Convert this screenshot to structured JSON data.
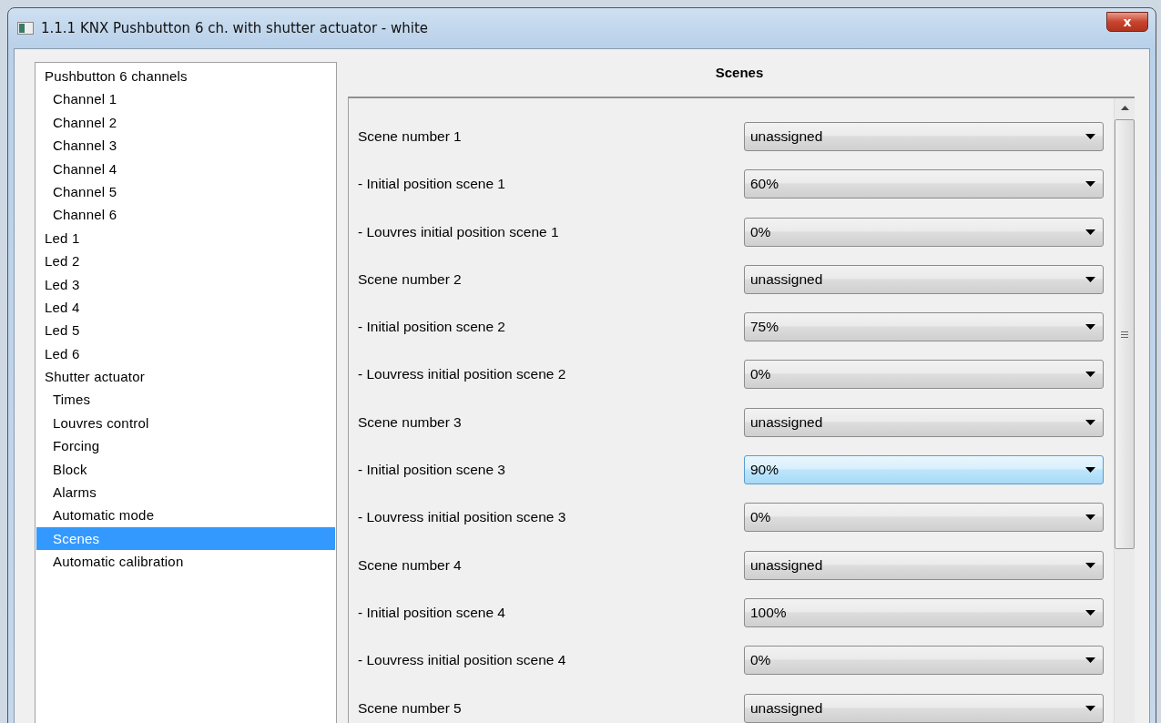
{
  "window": {
    "title": "1.1.1 KNX Pushbutton 6 ch. with shutter actuator - white",
    "close": "x"
  },
  "tree": [
    {
      "label": "Pushbutton 6 channels",
      "selected": false,
      "children": [
        {
          "label": "Channel 1",
          "selected": false
        },
        {
          "label": "Channel 2",
          "selected": false
        },
        {
          "label": "Channel 3",
          "selected": false
        },
        {
          "label": "Channel 4",
          "selected": false
        },
        {
          "label": "Channel 5",
          "selected": false
        },
        {
          "label": "Channel 6",
          "selected": false
        }
      ]
    },
    {
      "label": "Led 1",
      "selected": false
    },
    {
      "label": "Led 2",
      "selected": false
    },
    {
      "label": "Led 3",
      "selected": false
    },
    {
      "label": "Led 4",
      "selected": false
    },
    {
      "label": "Led 5",
      "selected": false
    },
    {
      "label": "Led 6",
      "selected": false
    },
    {
      "label": "Shutter actuator",
      "selected": false,
      "children": [
        {
          "label": "Times",
          "selected": false
        },
        {
          "label": "Louvres control",
          "selected": false
        },
        {
          "label": "Forcing",
          "selected": false
        },
        {
          "label": "Block",
          "selected": false
        },
        {
          "label": "Alarms",
          "selected": false
        },
        {
          "label": "Automatic mode",
          "selected": false
        },
        {
          "label": "Scenes",
          "selected": true
        },
        {
          "label": "Automatic calibration",
          "selected": false
        }
      ]
    }
  ],
  "section_title": "Scenes",
  "parameters": [
    {
      "label": "Scene number 1",
      "value": "unassigned",
      "highlighted": false
    },
    {
      "label": "- Initial position scene 1",
      "value": "60%",
      "highlighted": false
    },
    {
      "label": "- Louvres initial position scene 1",
      "value": "0%",
      "highlighted": false
    },
    {
      "label": "Scene number 2",
      "value": "unassigned",
      "highlighted": false
    },
    {
      "label": "- Initial position scene 2",
      "value": "75%",
      "highlighted": false
    },
    {
      "label": "- Louvress initial position scene 2",
      "value": "0%",
      "highlighted": false
    },
    {
      "label": "Scene number 3",
      "value": "unassigned",
      "highlighted": false
    },
    {
      "label": "- Initial position scene 3",
      "value": "90%",
      "highlighted": true
    },
    {
      "label": "- Louvress initial position scene 3",
      "value": "0%",
      "highlighted": false
    },
    {
      "label": "Scene number 4",
      "value": "unassigned",
      "highlighted": false
    },
    {
      "label": "- Initial position scene 4",
      "value": "100%",
      "highlighted": false
    },
    {
      "label": "- Louvress initial position scene 4",
      "value": "0%",
      "highlighted": false
    },
    {
      "label": "Scene number 5",
      "value": "unassigned",
      "highlighted": false
    }
  ]
}
